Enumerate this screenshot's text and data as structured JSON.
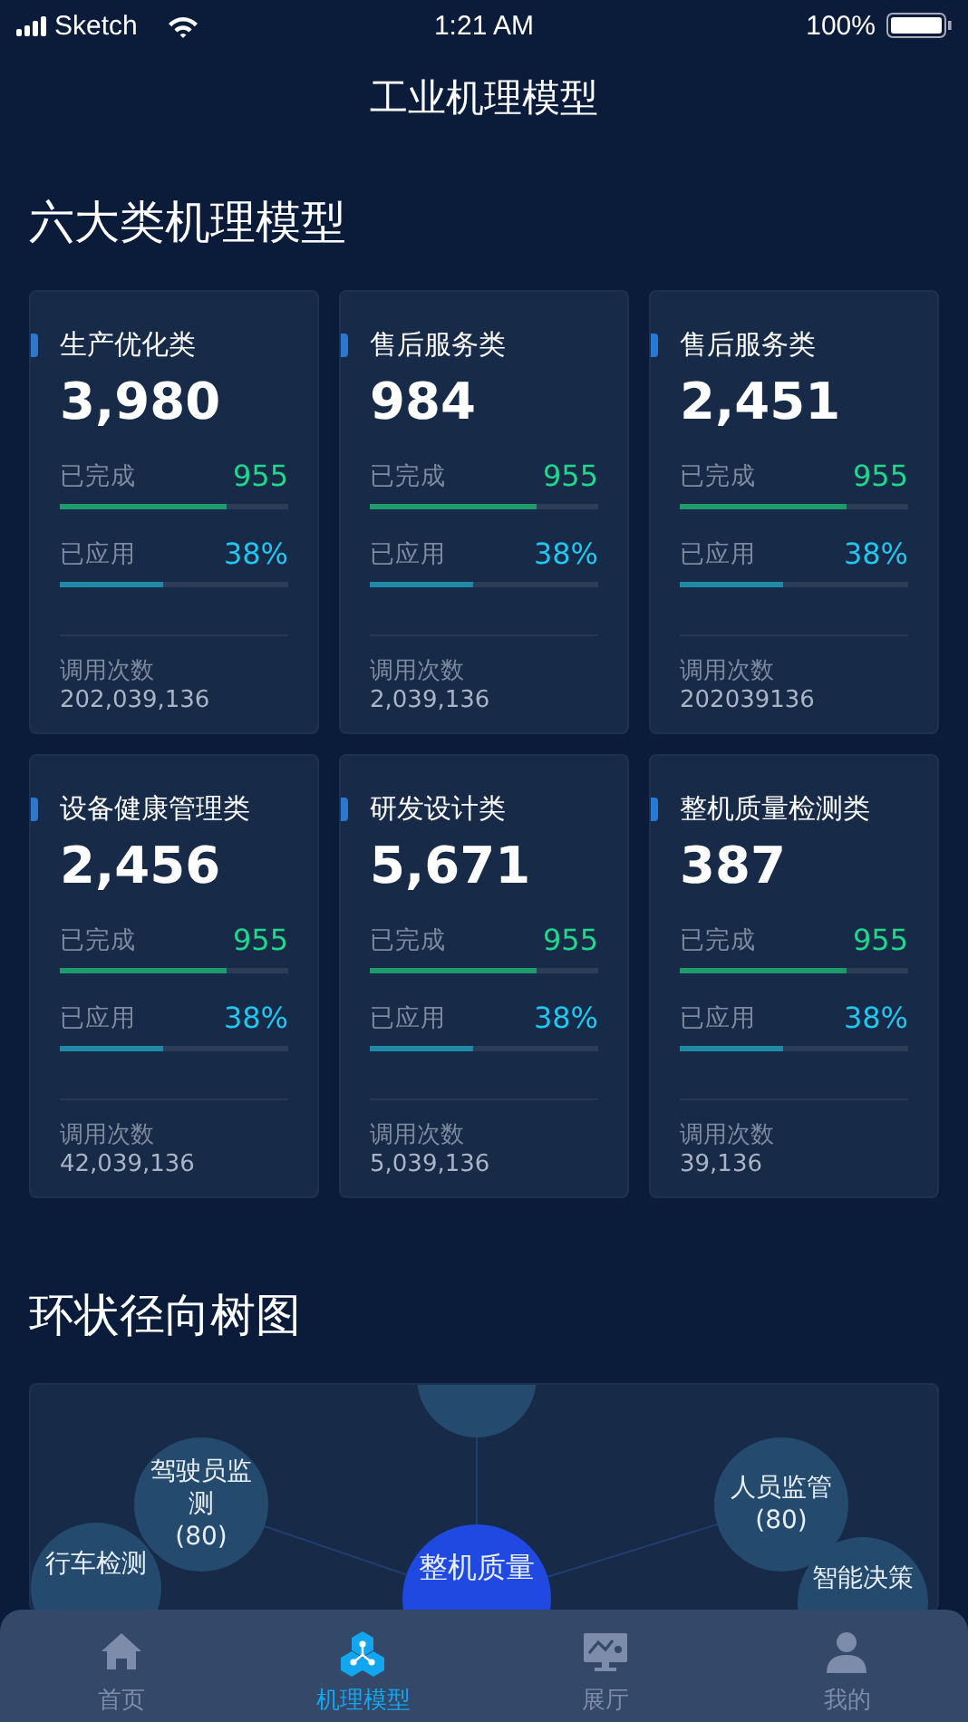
{
  "status_bar": {
    "carrier": "Sketch",
    "time": "1:21 AM",
    "battery": "100%"
  },
  "title": "工业机理模型",
  "models": {
    "heading": "六大类机理模型",
    "cards": [
      {
        "name": "生产优化类",
        "total": "3,980",
        "metrics": [
          {
            "kind": "completed",
            "label": "已完成",
            "value": "955",
            "level": 0.73
          },
          {
            "kind": "applied",
            "label": "已应用",
            "value": "38%",
            "level": 0.45
          }
        ],
        "calls_label": "调用次数",
        "calls": "202,039,136"
      },
      {
        "name": "售后服务类",
        "total": "984",
        "metrics": [
          {
            "kind": "completed",
            "label": "已完成",
            "value": "955",
            "level": 0.73
          },
          {
            "kind": "applied",
            "label": "已应用",
            "value": "38%",
            "level": 0.45
          }
        ],
        "calls_label": "调用次数",
        "calls": "2,039,136"
      },
      {
        "name": "售后服务类",
        "total": "2,451",
        "metrics": [
          {
            "kind": "completed",
            "label": "已完成",
            "value": "955",
            "level": 0.73
          },
          {
            "kind": "applied",
            "label": "已应用",
            "value": "38%",
            "level": 0.45
          }
        ],
        "calls_label": "调用次数",
        "calls": "202039136"
      },
      {
        "name": "设备健康管理类",
        "total": "2,456",
        "metrics": [
          {
            "kind": "completed",
            "label": "已完成",
            "value": "955",
            "level": 0.73
          },
          {
            "kind": "applied",
            "label": "已应用",
            "value": "38%",
            "level": 0.45
          }
        ],
        "calls_label": "调用次数",
        "calls": "42,039,136"
      },
      {
        "name": "研发设计类",
        "total": "5,671",
        "metrics": [
          {
            "kind": "completed",
            "label": "已完成",
            "value": "955",
            "level": 0.73
          },
          {
            "kind": "applied",
            "label": "已应用",
            "value": "38%",
            "level": 0.45
          }
        ],
        "calls_label": "调用次数",
        "calls": "5,039,136"
      },
      {
        "name": "整机质量检测类",
        "total": "387",
        "metrics": [
          {
            "kind": "completed",
            "label": "已完成",
            "value": "955",
            "level": 0.73
          },
          {
            "kind": "applied",
            "label": "已应用",
            "value": "38%",
            "level": 0.45
          }
        ],
        "calls_label": "调用次数",
        "calls": "39,136"
      }
    ]
  },
  "tree": {
    "heading": "环状径向树图",
    "nodes": [
      {
        "kind": "leaf",
        "label": "驾驶员监测",
        "count": "(80)"
      },
      {
        "kind": "leaf",
        "label": "行车检测"
      },
      {
        "kind": "root",
        "label": "整机质量"
      },
      {
        "kind": "leaf",
        "label": "人员监管",
        "count": "(80)"
      },
      {
        "kind": "leaf",
        "label": "智能决策"
      }
    ]
  },
  "tabs": [
    {
      "label": "首页",
      "selected": false
    },
    {
      "label": "机理模型",
      "selected": true
    },
    {
      "label": "展厅",
      "selected": false
    },
    {
      "label": "我的",
      "selected": false
    }
  ]
}
